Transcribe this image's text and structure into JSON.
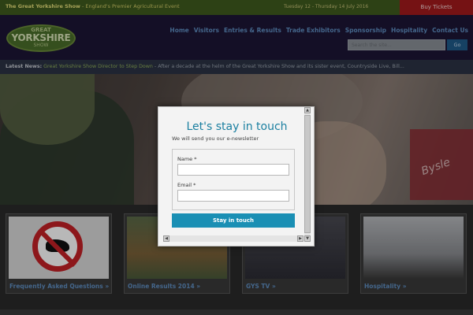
{
  "topbar": {
    "show_name": "The Great Yorkshire Show",
    "tagline": " - England's Premier Agricultural Event",
    "dates": "Tuesday 12 - Thursday 14 July 2016",
    "buy_tickets": "Buy Tickets"
  },
  "logo": {
    "line1": "GREAT",
    "line2": "YORKSHIRE",
    "line3": "SHOW"
  },
  "nav": {
    "items": [
      "Home",
      "Visitors",
      "Entries & Results",
      "Trade Exhibitors",
      "Sponsorship",
      "Hospitality",
      "Contact Us"
    ]
  },
  "search": {
    "placeholder": "Search the site...",
    "go": "Go"
  },
  "news": {
    "label": "Latest News:",
    "headline": "Great Yorkshire Show Director to Step Down",
    "snippet": " - After a decade at the helm of the Great Yorkshire Show and its sister event, Countryside Live, Bill..."
  },
  "tiles": [
    {
      "caption": "Frequently Asked Questions »"
    },
    {
      "caption": "Online Results 2014 »"
    },
    {
      "caption": "GYS TV »"
    },
    {
      "caption": "Hospitality »"
    }
  ],
  "hero": {
    "sign_text": "Bysle"
  },
  "modal": {
    "title": "Let's stay in touch",
    "subtitle": "We will send you our e-newsletter",
    "name_label": "Name *",
    "email_label": "Email *",
    "submit": "Stay in touch"
  },
  "colors": {
    "accent": "#1a8fb4",
    "nav_link": "#5f8ec1",
    "buy": "#a31a1c"
  }
}
